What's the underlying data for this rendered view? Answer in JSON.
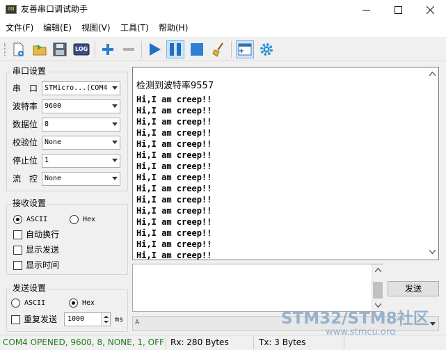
{
  "window": {
    "title": "友善串口调试助手",
    "minimize": "—",
    "maximize": "☐",
    "close": "✕"
  },
  "menu": [
    "文件(F)",
    "编辑(E)",
    "视图(V)",
    "工具(T)",
    "帮助(H)"
  ],
  "toolbar": {
    "log_label": "LOG"
  },
  "serial_settings": {
    "title": "串口设置",
    "fields": [
      {
        "label": "串　口",
        "value": "STMicro...(COM4"
      },
      {
        "label": "波特率",
        "value": "9600"
      },
      {
        "label": "数据位",
        "value": "8"
      },
      {
        "label": "校验位",
        "value": "None"
      },
      {
        "label": "停止位",
        "value": "1"
      },
      {
        "label": "流　控",
        "value": "None"
      }
    ]
  },
  "receive_settings": {
    "title": "接收设置",
    "ascii": "ASCII",
    "hex": "Hex",
    "auto_wrap": "自动换行",
    "show_send": "显示发送",
    "show_time": "显示时间"
  },
  "send_settings": {
    "title": "发送设置",
    "ascii": "ASCII",
    "hex": "Hex",
    "repeat": "重复发送",
    "interval": "1000",
    "unit": "ms"
  },
  "receive_area": {
    "title_line": "检测到波特率9557",
    "lines": [
      "Hi,I am creep!!",
      "Hi,I am creep!!",
      "Hi,I am creep!!",
      "Hi,I am creep!!",
      "Hi,I am creep!!",
      "Hi,I am creep!!",
      "Hi,I am creep!!",
      "Hi,I am creep!!",
      "Hi,I am creep!!",
      "Hi,I am creep!!",
      "Hi,I am creep!!",
      "Hi,I am creep!!",
      "Hi,I am creep!!",
      "Hi,I am creep!!",
      "Hi,I am creep!!"
    ]
  },
  "send_button": "发送",
  "history_value": "A",
  "status": {
    "port": "COM4 OPENED, 9600, 8, NONE, 1, OFF",
    "rx": "Rx: 280 Bytes",
    "tx": "Tx: 3 Bytes"
  },
  "watermark": {
    "main": "STM32/STM8社区",
    "sub": "www.stmcu.org"
  },
  "colors": {
    "status_text": "#1e7d1e",
    "accent": "#2b7bd1",
    "watermark": "#8aa9c7"
  }
}
